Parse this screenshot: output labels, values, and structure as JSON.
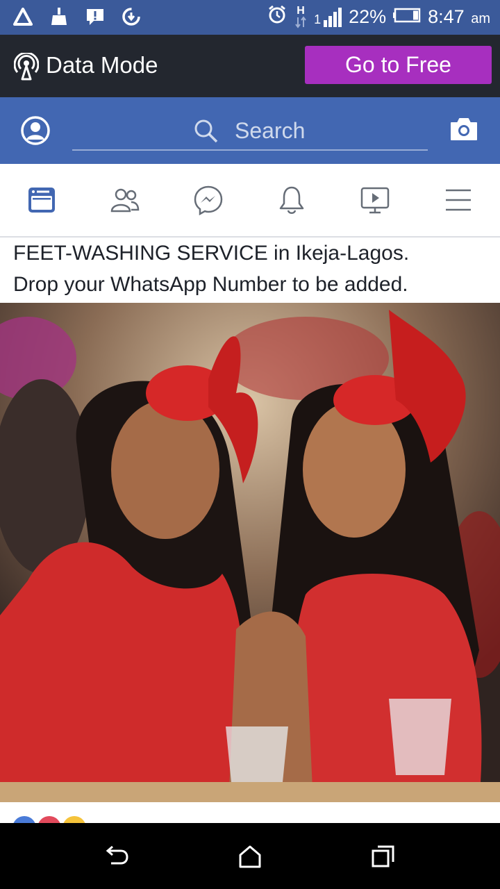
{
  "status_bar": {
    "battery": "22%",
    "time": "8:47",
    "ampm": "am",
    "network": "H",
    "signal_label": "1"
  },
  "data_mode": {
    "label": "Data Mode",
    "button": "Go to Free"
  },
  "header": {
    "search_placeholder": "Search"
  },
  "tabs": [
    "news-feed",
    "friends",
    "messenger",
    "notifications",
    "watch",
    "menu"
  ],
  "post": {
    "line1": "FEET-WASHING SERVICE in Ikeja-Lagos.",
    "line2": "Drop your WhatsApp Number to be added."
  },
  "colors": {
    "fb_blue": "#4267b2",
    "status_blue": "#3b5a9a",
    "data_bar": "#23272f",
    "go_free": "#a72fbf"
  }
}
